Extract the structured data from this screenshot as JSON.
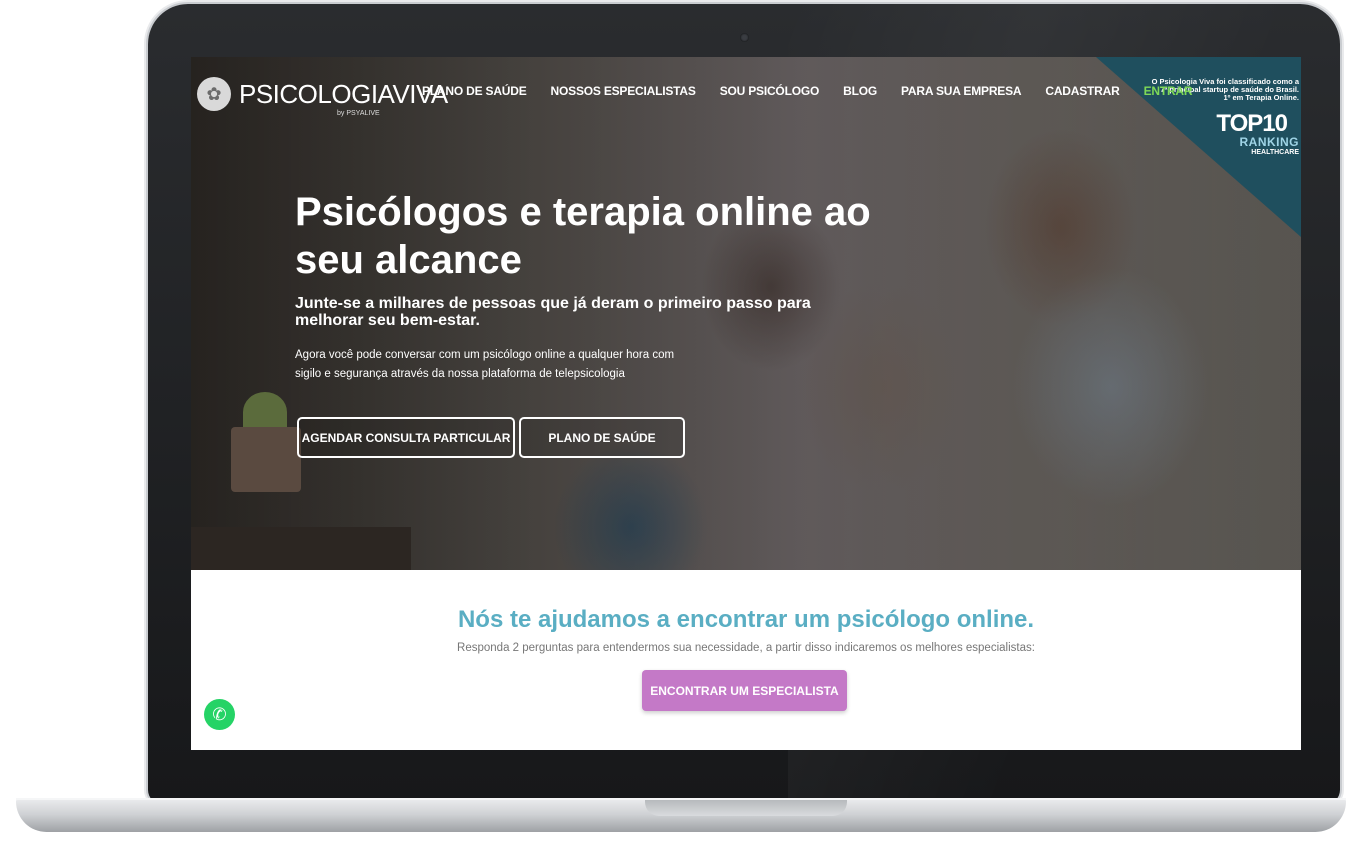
{
  "brand": {
    "name": "PSICOLOGIAVIVA",
    "byline": "by PSYALIVE"
  },
  "nav": {
    "items": [
      "PLANO DE SAÚDE",
      "NOSSOS ESPECIALISTAS",
      "SOU PSICÓLOGO",
      "BLOG",
      "PARA SUA EMPRESA",
      "CADASTRAR"
    ],
    "login": "ENTRAR"
  },
  "badge": {
    "line1": "O Psicologia Viva foi classificado como a",
    "line2": "7ª principal startup de saúde do Brasil.",
    "line3": "1º em Terapia Online.",
    "top10": "TOP10",
    "ranking": "RANKING",
    "category": "HEALTHCARE"
  },
  "hero": {
    "headline": "Psicólogos e terapia online ao seu alcance",
    "subhead": "Junte-se a milhares de pessoas que já deram o primeiro passo para melhorar seu bem-estar.",
    "body": "Agora você pode conversar com um psicólogo online a qualquer hora com sigilo e segurança através da nossa plataforma de telepsicologia",
    "btn_private": "AGENDAR CONSULTA PARTICULAR",
    "btn_plan": "PLANO DE SAÚDE"
  },
  "help": {
    "title": "Nós te ajudamos a encontrar um psicólogo online.",
    "subtitle": "Responda 2 perguntas para entendermos sua necessidade, a partir disso indicaremos os melhores especialistas:",
    "button": "ENCONTRAR UM ESPECIALISTA"
  },
  "colors": {
    "accent_teal": "#5aaec3",
    "cta_purple": "#c479c7",
    "login_green": "#7ed957",
    "badge_bg": "#1f4f5e",
    "whatsapp": "#25d366"
  },
  "icons": {
    "logo": "flower-logo-icon",
    "whatsapp": "whatsapp-icon"
  }
}
